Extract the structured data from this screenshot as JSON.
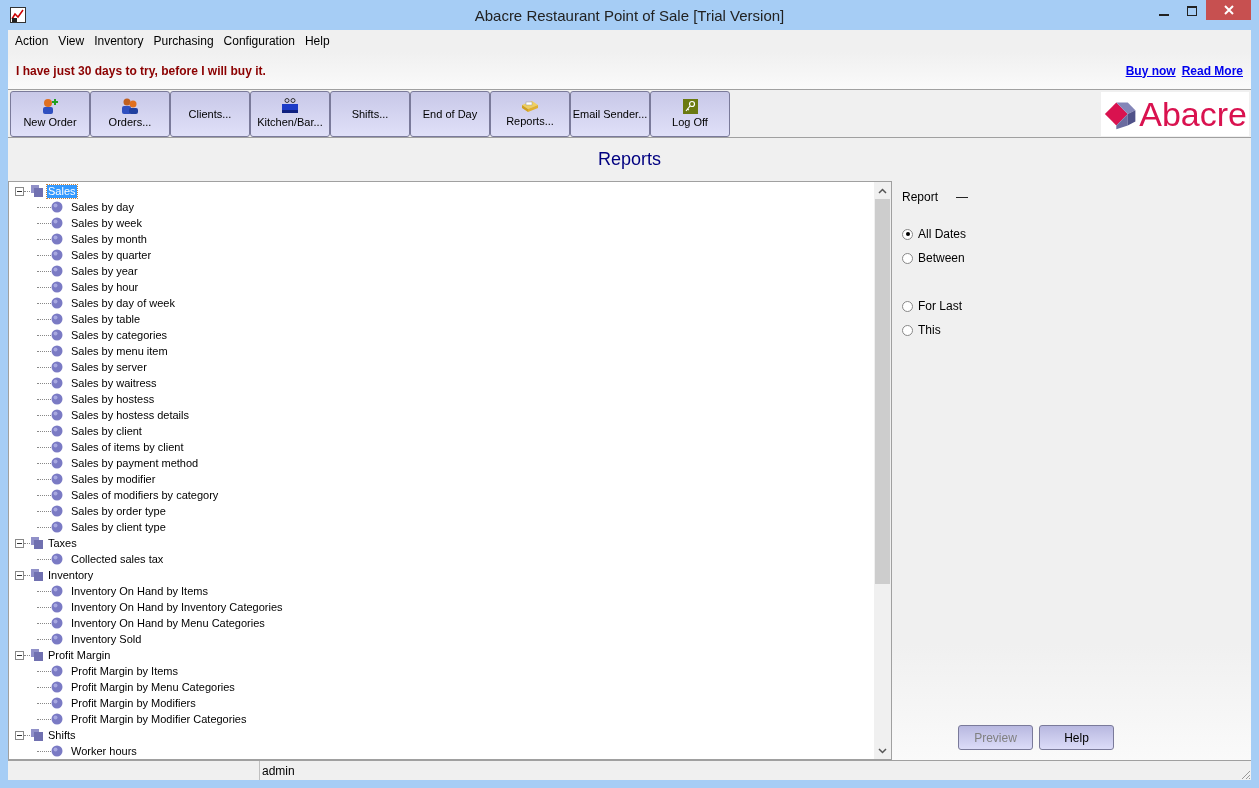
{
  "window": {
    "title": "Abacre Restaurant Point of Sale [Trial Version]"
  },
  "menu": [
    "Action",
    "View",
    "Inventory",
    "Purchasing",
    "Configuration",
    "Help"
  ],
  "trial_banner": {
    "message": "I have just 30 days to try, before I will buy it.",
    "links": [
      "Buy now",
      "Read More"
    ]
  },
  "toolbar": [
    "New Order",
    "Orders...",
    "Clients...",
    "Kitchen/Bar...",
    "Shifts...",
    "End of Day",
    "Reports...",
    "Email Sender...",
    "Log Off"
  ],
  "logo": {
    "text": "Abacre"
  },
  "page_title": "Reports",
  "tree": [
    {
      "label": "Sales",
      "selected": true,
      "expanded": true,
      "children": [
        {
          "label": "Sales by day",
          "selected": false
        },
        {
          "label": "Sales by week",
          "selected": false
        },
        {
          "label": "Sales by month",
          "selected": false
        },
        {
          "label": "Sales by quarter",
          "selected": false
        },
        {
          "label": "Sales by year",
          "selected": false
        },
        {
          "label": "Sales by hour",
          "selected": false
        },
        {
          "label": "Sales by day of week",
          "selected": false
        },
        {
          "label": "Sales by table",
          "selected": false
        },
        {
          "label": "Sales by categories",
          "selected": false
        },
        {
          "label": "Sales by menu item",
          "selected": false
        },
        {
          "label": "Sales by server",
          "selected": false
        },
        {
          "label": "Sales by waitress",
          "selected": false
        },
        {
          "label": "Sales by hostess",
          "selected": false
        },
        {
          "label": "Sales by hostess details",
          "selected": false
        },
        {
          "label": "Sales by client",
          "selected": false
        },
        {
          "label": "Sales of items by client",
          "selected": false
        },
        {
          "label": "Sales by payment method",
          "selected": false
        },
        {
          "label": "Sales by modifier",
          "selected": false
        },
        {
          "label": "Sales of modifiers by category",
          "selected": false
        },
        {
          "label": "Sales by order type",
          "selected": false
        },
        {
          "label": "Sales by client type",
          "selected": false
        }
      ]
    },
    {
      "label": "Taxes",
      "selected": false,
      "expanded": true,
      "children": [
        {
          "label": "Collected sales tax",
          "selected": false
        }
      ]
    },
    {
      "label": "Inventory",
      "selected": false,
      "expanded": true,
      "children": [
        {
          "label": "Inventory On Hand by Items",
          "selected": false
        },
        {
          "label": "Inventory On Hand by Inventory Categories",
          "selected": false
        },
        {
          "label": "Inventory On Hand by Menu Categories",
          "selected": false
        },
        {
          "label": "Inventory Sold",
          "selected": false
        }
      ]
    },
    {
      "label": "Profit Margin",
      "selected": false,
      "expanded": true,
      "children": [
        {
          "label": "Profit Margin by Items",
          "selected": false
        },
        {
          "label": "Profit Margin by Menu Categories",
          "selected": false
        },
        {
          "label": "Profit Margin by Modifiers",
          "selected": false
        },
        {
          "label": "Profit Margin by Modifier Categories",
          "selected": false
        }
      ]
    },
    {
      "label": "Shifts",
      "selected": false,
      "expanded": true,
      "children": [
        {
          "label": "Worker hours",
          "selected": false
        }
      ]
    }
  ],
  "report_panel": {
    "label": "Report",
    "value": "—",
    "date_options": [
      {
        "label": "All Dates",
        "selected": true
      },
      {
        "label": "Between",
        "selected": false
      },
      {
        "label": "For Last",
        "selected": false
      },
      {
        "label": "This",
        "selected": false
      }
    ],
    "buttons": [
      {
        "label": "Preview",
        "disabled": true
      },
      {
        "label": "Help",
        "disabled": false
      }
    ]
  },
  "status_bar": {
    "user": "admin"
  }
}
